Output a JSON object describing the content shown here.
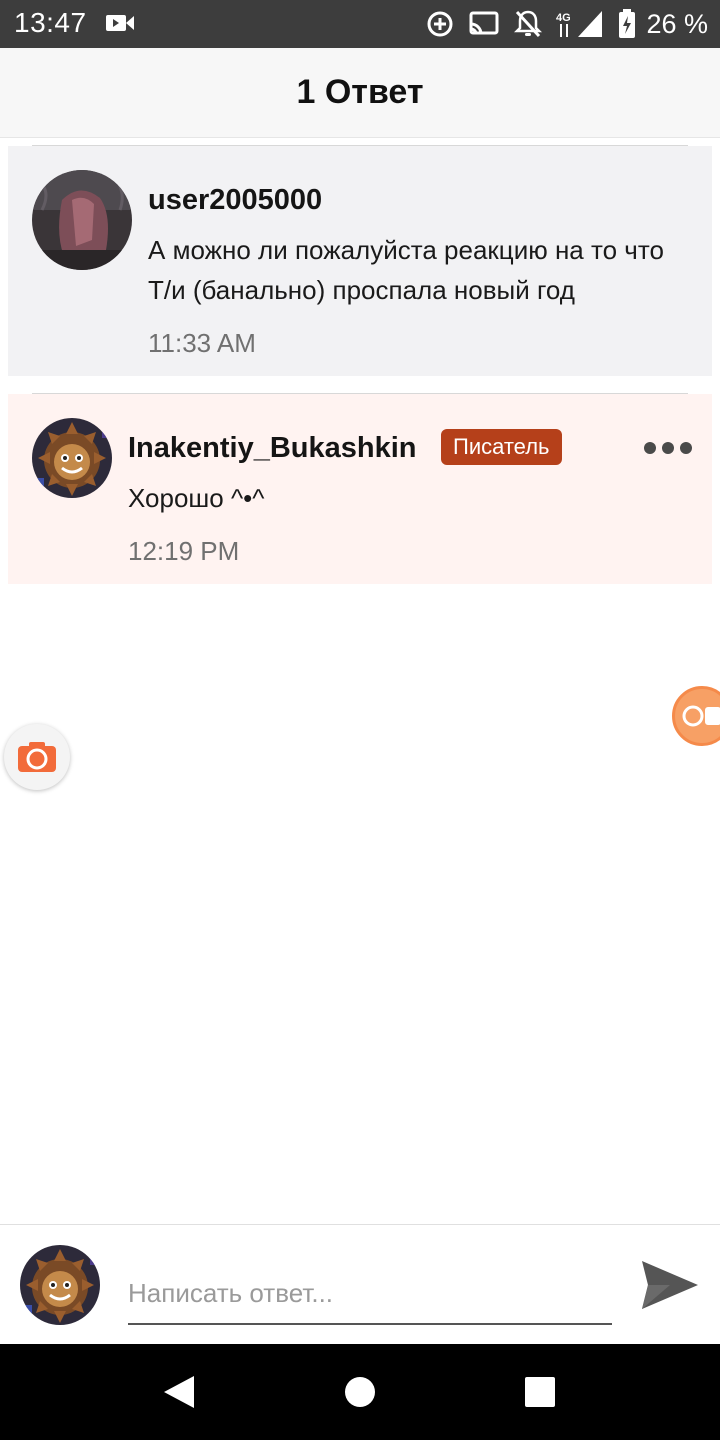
{
  "status_bar": {
    "time": "13:47",
    "battery": "26 %",
    "icons": [
      "video-icon",
      "data-saver-icon",
      "cast-icon",
      "notifications-off-icon",
      "4g-icon",
      "signal-icon",
      "battery-icon"
    ]
  },
  "header": {
    "title": "1 Ответ"
  },
  "original_comment": {
    "username": "user2005000",
    "text": "А можно ли пожалуйста реакцию на то что Т/и (банально) проспала новый год",
    "time": "11:33 AM"
  },
  "reply_comment": {
    "username": "Inakentiy_Bukashkin",
    "badge": "Писатель",
    "text": "Хорошо ^•^",
    "time": "12:19 PM"
  },
  "composer": {
    "placeholder": "Написать ответ..."
  },
  "colors": {
    "status_bar": "#3d3d3d",
    "badge": "#b5401a",
    "reply_bg": "#fff3f1",
    "original_bg": "#f2f2f4",
    "accent_orange": "#f58a4a"
  }
}
